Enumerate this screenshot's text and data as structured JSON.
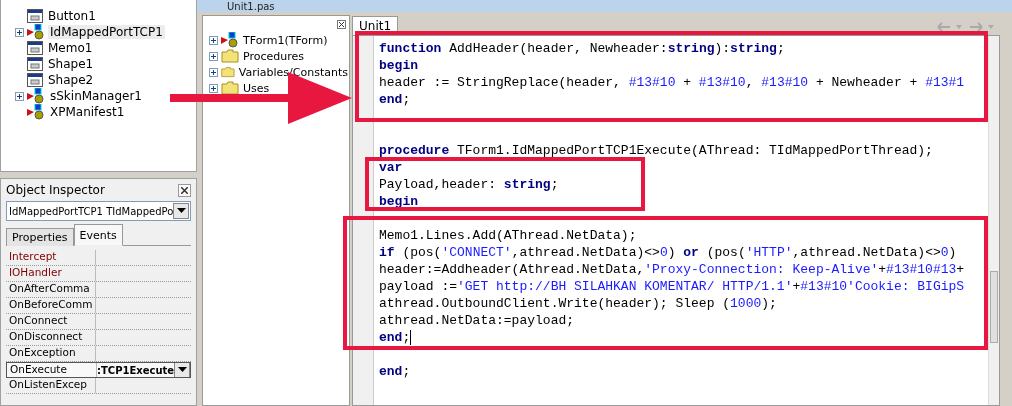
{
  "form_tree": {
    "items": [
      {
        "label": "Button1",
        "kind": "control",
        "expandable": false,
        "selected": false
      },
      {
        "label": "IdMappedPortTCP1",
        "kind": "component",
        "expandable": true,
        "selected": true
      },
      {
        "label": "Memo1",
        "kind": "control",
        "expandable": false,
        "selected": false
      },
      {
        "label": "Shape1",
        "kind": "control",
        "expandable": false,
        "selected": false
      },
      {
        "label": "Shape2",
        "kind": "control",
        "expandable": false,
        "selected": false
      },
      {
        "label": "sSkinManager1",
        "kind": "component",
        "expandable": true,
        "selected": false
      },
      {
        "label": "XPManifest1",
        "kind": "component",
        "expandable": false,
        "selected": false
      }
    ]
  },
  "object_inspector": {
    "title": "Object Inspector",
    "object_select": "IdMappedPortTCP1 TIdMappedPo",
    "tabs": [
      {
        "label": "Properties",
        "selected": false
      },
      {
        "label": "Events",
        "selected": true
      }
    ],
    "events": [
      {
        "name": "Intercept",
        "kind": "reference",
        "selected": false
      },
      {
        "name": "IOHandler",
        "kind": "reference",
        "selected": false
      },
      {
        "name": "OnAfterComma",
        "kind": "event",
        "selected": false
      },
      {
        "name": "OnBeforeComm",
        "kind": "event",
        "selected": false
      },
      {
        "name": "OnConnect",
        "kind": "event",
        "selected": false
      },
      {
        "name": "OnDisconnect",
        "kind": "event",
        "selected": false
      },
      {
        "name": "OnException",
        "kind": "event",
        "selected": false
      },
      {
        "name": "OnExecute",
        "kind": "event",
        "selected": true,
        "value": ":TCP1Execute"
      },
      {
        "name": "OnListenExcep",
        "kind": "event",
        "selected": false
      }
    ]
  },
  "window": {
    "title": "Unit1.pas"
  },
  "code_explorer": {
    "items": [
      {
        "label": "TForm1(TForm)",
        "kind": "class"
      },
      {
        "label": "Procedures",
        "kind": "folder"
      },
      {
        "label": "Variables/Constants",
        "kind": "folder"
      },
      {
        "label": "Uses",
        "kind": "folder"
      }
    ]
  },
  "editor": {
    "tabs": [
      {
        "label": "Unit1",
        "selected": true
      }
    ],
    "lines": [
      {
        "kind": "code",
        "tokens": [
          {
            "text": "function",
            "kind": "keyword"
          },
          {
            "text": " AddHeader(header, Newheader:",
            "kind": "plain"
          },
          {
            "text": "string",
            "kind": "keyword"
          },
          {
            "text": "):",
            "kind": "plain"
          },
          {
            "text": "string",
            "kind": "keyword"
          },
          {
            "text": ";",
            "kind": "plain"
          }
        ]
      },
      {
        "kind": "code",
        "tokens": [
          {
            "text": "begin",
            "kind": "keyword"
          }
        ]
      },
      {
        "kind": "code",
        "tokens": [
          {
            "text": "header := StringReplace(header, ",
            "kind": "plain"
          },
          {
            "text": "#13#10",
            "kind": "string"
          },
          {
            "text": " + ",
            "kind": "plain"
          },
          {
            "text": "#13#10",
            "kind": "string"
          },
          {
            "text": ", ",
            "kind": "plain"
          },
          {
            "text": "#13#10",
            "kind": "string"
          },
          {
            "text": " + Newheader + ",
            "kind": "plain"
          },
          {
            "text": "#13#1",
            "kind": "string"
          }
        ]
      },
      {
        "kind": "code",
        "tokens": [
          {
            "text": "end",
            "kind": "keyword"
          },
          {
            "text": ";",
            "kind": "plain"
          }
        ]
      },
      {
        "kind": "blank"
      },
      {
        "kind": "blank"
      },
      {
        "kind": "code",
        "tokens": [
          {
            "text": "procedure",
            "kind": "keyword"
          },
          {
            "text": " TForm1.IdMappedPortTCP1Execute(AThread: TIdMappedPortThread);",
            "kind": "plain"
          }
        ]
      },
      {
        "kind": "code",
        "tokens": [
          {
            "text": "var",
            "kind": "keyword"
          }
        ]
      },
      {
        "kind": "code",
        "tokens": [
          {
            "text": "Payload,header: ",
            "kind": "plain"
          },
          {
            "text": "string",
            "kind": "keyword"
          },
          {
            "text": ";",
            "kind": "plain"
          }
        ]
      },
      {
        "kind": "code",
        "tokens": [
          {
            "text": "begin",
            "kind": "keyword"
          }
        ]
      },
      {
        "kind": "blank"
      },
      {
        "kind": "code",
        "tokens": [
          {
            "text": "Memo1.Lines.Add(AThread.NetData);",
            "kind": "plain"
          }
        ]
      },
      {
        "kind": "code",
        "tokens": [
          {
            "text": "if",
            "kind": "keyword"
          },
          {
            "text": " (pos(",
            "kind": "plain"
          },
          {
            "text": "'CONNECT'",
            "kind": "string"
          },
          {
            "text": ",athread.NetData)<>",
            "kind": "plain"
          },
          {
            "text": "0",
            "kind": "string"
          },
          {
            "text": ") ",
            "kind": "plain"
          },
          {
            "text": "or",
            "kind": "keyword"
          },
          {
            "text": " (pos(",
            "kind": "plain"
          },
          {
            "text": "'HTTP'",
            "kind": "string"
          },
          {
            "text": ",athread.NetData)<>",
            "kind": "plain"
          },
          {
            "text": "0",
            "kind": "string"
          },
          {
            "text": ")",
            "kind": "plain"
          }
        ]
      },
      {
        "kind": "code",
        "tokens": [
          {
            "text": "header:=Addheader(Athread.NetData,",
            "kind": "plain"
          },
          {
            "text": "'Proxy-Connection: Keep-Alive'",
            "kind": "string"
          },
          {
            "text": "+",
            "kind": "plain"
          },
          {
            "text": "#13#10#13",
            "kind": "string"
          },
          {
            "text": "+",
            "kind": "plain"
          }
        ]
      },
      {
        "kind": "code",
        "tokens": [
          {
            "text": "payload :=",
            "kind": "plain"
          },
          {
            "text": "'GET http://BH SILAHKAN KOMENTAR/ HTTP/1.1'",
            "kind": "string"
          },
          {
            "text": "+",
            "kind": "plain"
          },
          {
            "text": "#13#10'Cookie: BIGipS",
            "kind": "string"
          }
        ]
      },
      {
        "kind": "code",
        "tokens": [
          {
            "text": "athread.OutboundClient.Write(header); Sleep (",
            "kind": "plain"
          },
          {
            "text": "1000",
            "kind": "string"
          },
          {
            "text": ");",
            "kind": "plain"
          }
        ]
      },
      {
        "kind": "code",
        "tokens": [
          {
            "text": "athread.NetData:=payload;",
            "kind": "plain"
          }
        ]
      },
      {
        "kind": "code",
        "cursor": true,
        "tokens": [
          {
            "text": "end",
            "kind": "keyword"
          },
          {
            "text": ";",
            "kind": "plain"
          }
        ]
      },
      {
        "kind": "blank"
      },
      {
        "kind": "code",
        "tokens": [
          {
            "text": "end",
            "kind": "keyword"
          },
          {
            "text": ";",
            "kind": "plain"
          }
        ]
      }
    ]
  }
}
